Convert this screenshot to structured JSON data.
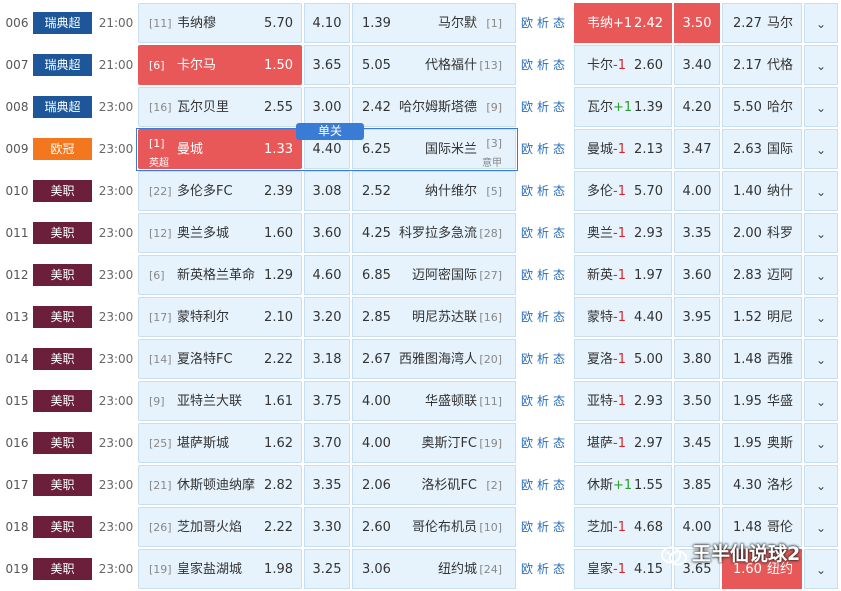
{
  "colors": {
    "league_sweden": "#1e5799",
    "league_europe": "#f3771f",
    "league_usa": "#6b1f3b",
    "highlight": "#e85858",
    "cell_bg": "#e6f3fd"
  },
  "link_labels": {
    "europe": "欧",
    "analysis": "析",
    "state": "态"
  },
  "expand_icon": "chevron-down-icon",
  "badge_label": "单关",
  "row009_sub": {
    "home_sub": "英超",
    "away_sub": "意甲"
  },
  "watermark": {
    "text": "王半仙说球2",
    "icon": "wechat-icon"
  },
  "rows": [
    {
      "num": "006",
      "league": "瑞典超",
      "league_color": "#1e5799",
      "time": "21:00",
      "home_rank": "[11]",
      "home": "韦纳穆",
      "home_odds": "5.70",
      "draw_odds": "4.10",
      "away_odds": "1.39",
      "away": "马尔默",
      "away_rank": "[1]",
      "h_team": "韦纳",
      "h_sign": "+",
      "h_num": "1",
      "h_odds": "2.42",
      "h_draw": "3.50",
      "h_away_odds": "2.27",
      "h_away": "马尔"
    },
    {
      "num": "007",
      "league": "瑞典超",
      "league_color": "#1e5799",
      "time": "21:00",
      "home_rank": "[6]",
      "home": "卡尔马",
      "home_odds": "1.50",
      "draw_odds": "3.65",
      "away_odds": "5.05",
      "away": "代格福什",
      "away_rank": "[13]",
      "h_team": "卡尔",
      "h_sign": "-",
      "h_num": "1",
      "h_odds": "2.60",
      "h_draw": "3.40",
      "h_away_odds": "2.17",
      "h_away": "代格"
    },
    {
      "num": "008",
      "league": "瑞典超",
      "league_color": "#1e5799",
      "time": "23:00",
      "home_rank": "[16]",
      "home": "瓦尔贝里",
      "home_odds": "2.55",
      "draw_odds": "3.00",
      "away_odds": "2.42",
      "away": "哈尔姆斯塔德",
      "away_rank": "[9]",
      "h_team": "瓦尔",
      "h_sign": "+",
      "h_num": "1",
      "h_odds": "1.39",
      "h_draw": "4.20",
      "h_away_odds": "5.50",
      "h_away": "哈尔"
    },
    {
      "num": "009",
      "league": "欧冠",
      "league_color": "#f3771f",
      "time": "23:00",
      "home_rank": "[1]",
      "home": "曼城",
      "home_odds": "1.33",
      "draw_odds": "4.40",
      "away_odds": "6.25",
      "away": "国际米兰",
      "away_rank": "[3]",
      "h_team": "曼城",
      "h_sign": "-",
      "h_num": "1",
      "h_odds": "2.13",
      "h_draw": "3.47",
      "h_away_odds": "2.63",
      "h_away": "国际"
    },
    {
      "num": "010",
      "league": "美职",
      "league_color": "#6b1f3b",
      "time": "23:00",
      "home_rank": "[22]",
      "home": "多伦多FC",
      "home_odds": "2.39",
      "draw_odds": "3.08",
      "away_odds": "2.52",
      "away": "纳什维尔",
      "away_rank": "[5]",
      "h_team": "多伦",
      "h_sign": "-",
      "h_num": "1",
      "h_odds": "5.70",
      "h_draw": "4.00",
      "h_away_odds": "1.40",
      "h_away": "纳什"
    },
    {
      "num": "011",
      "league": "美职",
      "league_color": "#6b1f3b",
      "time": "23:00",
      "home_rank": "[12]",
      "home": "奥兰多城",
      "home_odds": "1.60",
      "draw_odds": "3.60",
      "away_odds": "4.25",
      "away": "科罗拉多急流",
      "away_rank": "[28]",
      "h_team": "奥兰",
      "h_sign": "-",
      "h_num": "1",
      "h_odds": "2.93",
      "h_draw": "3.35",
      "h_away_odds": "2.00",
      "h_away": "科罗"
    },
    {
      "num": "012",
      "league": "美职",
      "league_color": "#6b1f3b",
      "time": "23:00",
      "home_rank": "[6]",
      "home": "新英格兰革命",
      "home_odds": "1.29",
      "draw_odds": "4.60",
      "away_odds": "6.85",
      "away": "迈阿密国际",
      "away_rank": "[27]",
      "h_team": "新英",
      "h_sign": "-",
      "h_num": "1",
      "h_odds": "1.97",
      "h_draw": "3.60",
      "h_away_odds": "2.83",
      "h_away": "迈阿"
    },
    {
      "num": "013",
      "league": "美职",
      "league_color": "#6b1f3b",
      "time": "23:00",
      "home_rank": "[17]",
      "home": "蒙特利尔",
      "home_odds": "2.10",
      "draw_odds": "3.20",
      "away_odds": "2.85",
      "away": "明尼苏达联",
      "away_rank": "[16]",
      "h_team": "蒙特",
      "h_sign": "-",
      "h_num": "1",
      "h_odds": "4.40",
      "h_draw": "3.95",
      "h_away_odds": "1.52",
      "h_away": "明尼"
    },
    {
      "num": "014",
      "league": "美职",
      "league_color": "#6b1f3b",
      "time": "23:00",
      "home_rank": "[14]",
      "home": "夏洛特FC",
      "home_odds": "2.22",
      "draw_odds": "3.18",
      "away_odds": "2.67",
      "away": "西雅图海湾人",
      "away_rank": "[20]",
      "h_team": "夏洛",
      "h_sign": "-",
      "h_num": "1",
      "h_odds": "5.00",
      "h_draw": "3.80",
      "h_away_odds": "1.48",
      "h_away": "西雅"
    },
    {
      "num": "015",
      "league": "美职",
      "league_color": "#6b1f3b",
      "time": "23:00",
      "home_rank": "[9]",
      "home": "亚特兰大联",
      "home_odds": "1.61",
      "draw_odds": "3.75",
      "away_odds": "4.00",
      "away": "华盛顿联",
      "away_rank": "[11]",
      "h_team": "亚特",
      "h_sign": "-",
      "h_num": "1",
      "h_odds": "2.93",
      "h_draw": "3.50",
      "h_away_odds": "1.95",
      "h_away": "华盛"
    },
    {
      "num": "016",
      "league": "美职",
      "league_color": "#6b1f3b",
      "time": "23:00",
      "home_rank": "[25]",
      "home": "堪萨斯城",
      "home_odds": "1.62",
      "draw_odds": "3.70",
      "away_odds": "4.00",
      "away": "奥斯汀FC",
      "away_rank": "[19]",
      "h_team": "堪萨",
      "h_sign": "-",
      "h_num": "1",
      "h_odds": "2.97",
      "h_draw": "3.45",
      "h_away_odds": "1.95",
      "h_away": "奥斯"
    },
    {
      "num": "017",
      "league": "美职",
      "league_color": "#6b1f3b",
      "time": "23:00",
      "home_rank": "[21]",
      "home": "休斯顿迪纳摩",
      "home_odds": "2.82",
      "draw_odds": "3.35",
      "away_odds": "2.06",
      "away": "洛杉矶FC",
      "away_rank": "[2]",
      "h_team": "休斯",
      "h_sign": "+",
      "h_num": "1",
      "h_odds": "1.55",
      "h_draw": "3.85",
      "h_away_odds": "4.30",
      "h_away": "洛杉"
    },
    {
      "num": "018",
      "league": "美职",
      "league_color": "#6b1f3b",
      "time": "23:00",
      "home_rank": "[26]",
      "home": "芝加哥火焰",
      "home_odds": "2.22",
      "draw_odds": "3.30",
      "away_odds": "2.60",
      "away": "哥伦布机员",
      "away_rank": "[10]",
      "h_team": "芝加",
      "h_sign": "-",
      "h_num": "1",
      "h_odds": "4.68",
      "h_draw": "4.00",
      "h_away_odds": "1.48",
      "h_away": "哥伦"
    },
    {
      "num": "019",
      "league": "美职",
      "league_color": "#6b1f3b",
      "time": "23:00",
      "home_rank": "[19]",
      "home": "皇家盐湖城",
      "home_odds": "1.98",
      "draw_odds": "3.25",
      "away_odds": "3.06",
      "away": "纽约城",
      "away_rank": "[24]",
      "h_team": "皇家",
      "h_sign": "-",
      "h_num": "1",
      "h_odds": "4.15",
      "h_draw": "3.65",
      "h_away_odds": "1.60",
      "h_away": "纽约"
    }
  ]
}
